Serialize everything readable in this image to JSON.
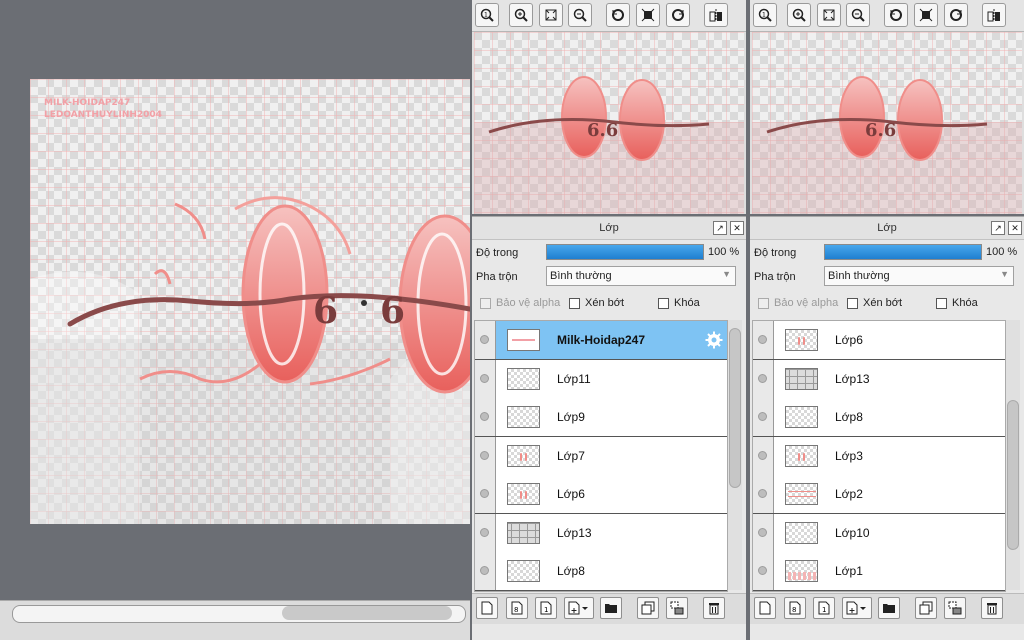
{
  "canvas": {
    "watermark_lines": [
      "MILK-HOIDAP247",
      "LEDOANTHUYLINH2004"
    ],
    "artwork_text": "6.6",
    "artwork_color": "#f08e8a",
    "background_color": "#6b6e74"
  },
  "navigator": {
    "tools": [
      "zoom-fit-icon",
      "zoom-in-icon",
      "fit-screen-icon",
      "zoom-out-icon",
      "rotate-left-icon",
      "reset-rotation-icon",
      "rotate-right-icon",
      "flip-icon"
    ]
  },
  "layer_panels": [
    {
      "title": "Lớp",
      "opacity_label": "Độ trong",
      "opacity_value": "100 %",
      "blend_label": "Pha trộn",
      "blend_value": "Bình thường",
      "checkbox_protect_alpha": "Bảo vệ alpha",
      "checkbox_clip": "Xén bớt",
      "checkbox_lock": "Khóa",
      "layers": [
        {
          "name": "Milk-Hoidap247",
          "selected": true
        },
        {
          "name": "Lớp11"
        },
        {
          "name": "Lớp9"
        },
        {
          "name": "Lớp7"
        },
        {
          "name": "Lớp6"
        },
        {
          "name": "Lớp13"
        },
        {
          "name": "Lớp8"
        }
      ]
    },
    {
      "title": "Lớp",
      "opacity_label": "Độ trong",
      "opacity_value": "100 %",
      "blend_label": "Pha trộn",
      "blend_value": "Bình thường",
      "checkbox_protect_alpha": "Bảo vệ alpha",
      "checkbox_clip": "Xén bớt",
      "checkbox_lock": "Khóa",
      "layers": [
        {
          "name": "Lớp6"
        },
        {
          "name": "Lớp13"
        },
        {
          "name": "Lớp8"
        },
        {
          "name": "Lớp3"
        },
        {
          "name": "Lớp2"
        },
        {
          "name": "Lớp10"
        },
        {
          "name": "Lớp1"
        }
      ]
    }
  ],
  "colors": {
    "selected_row": "#7ec3f3",
    "opacity_bar": "#2e8fe0",
    "pink": "#f08e8a"
  }
}
